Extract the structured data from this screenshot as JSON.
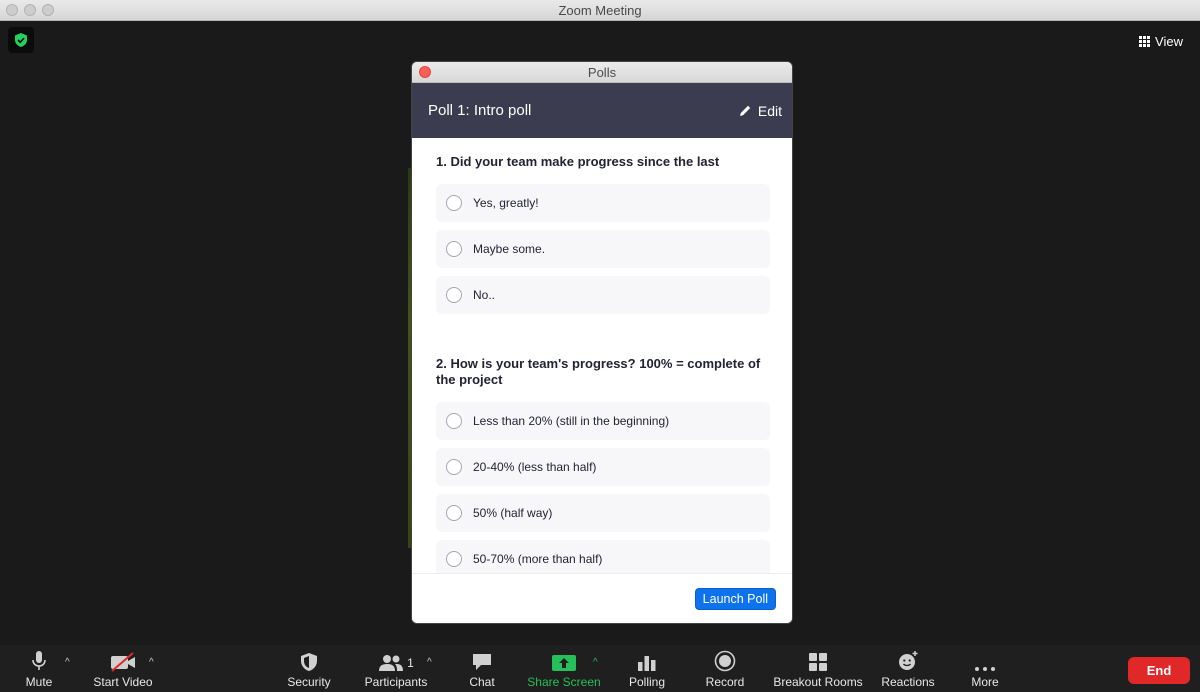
{
  "window": {
    "title": "Zoom Meeting"
  },
  "stage": {
    "view_label": "View"
  },
  "polls": {
    "window_title": "Polls",
    "poll_name": "Poll 1: Intro poll",
    "edit_label": "Edit",
    "questions": [
      {
        "text": "1. Did your team make progress since the last",
        "options": [
          "Yes, greatly!",
          "Maybe some.",
          "No.."
        ]
      },
      {
        "text": "2. How is your team's progress? 100% = complete of the project",
        "options": [
          "Less than 20% (still in the beginning)",
          "20-40% (less than half)",
          "50% (half way)",
          "50-70% (more than half)"
        ]
      }
    ],
    "launch_label": "Launch Poll"
  },
  "toolbar": {
    "mute": "Mute",
    "start_video": "Start Video",
    "security": "Security",
    "participants": "Participants",
    "participants_count": "1",
    "chat": "Chat",
    "share_screen": "Share Screen",
    "polling": "Polling",
    "record": "Record",
    "breakout_rooms": "Breakout Rooms",
    "reactions": "Reactions",
    "more": "More",
    "end": "End"
  },
  "colors": {
    "poll_header": "#3b3c4f",
    "launch_button": "#0e72ed",
    "share_green": "#25c05a",
    "end_red": "#e02828"
  }
}
